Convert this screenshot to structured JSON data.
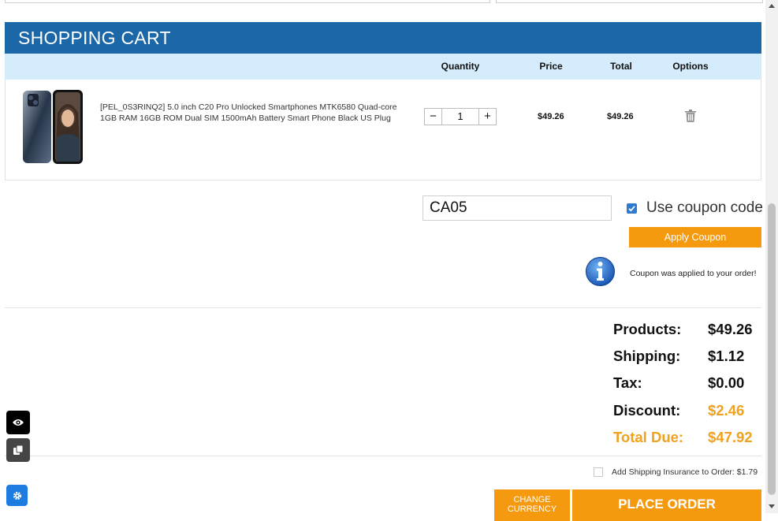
{
  "cart": {
    "title": "SHOPPING CART",
    "columns": {
      "quantity": "Quantity",
      "price": "Price",
      "total": "Total",
      "options": "Options"
    },
    "item": {
      "description": "[PEL_0S3RINQ2] 5.0 inch C20 Pro Unlocked Smartphones MTK6580 Quad-core 1GB RAM 16GB ROM Dual SIM 1500mAh Battery Smart Phone Black US Plug",
      "quantity": "1",
      "minus": "−",
      "plus": "+",
      "price": "$49.26",
      "total": "$49.26"
    }
  },
  "coupon": {
    "code": "CA05",
    "checked": true,
    "label": "Use coupon code",
    "apply_label": "Apply Coupon",
    "message": "Coupon was applied to your order!"
  },
  "summary": {
    "products_label": "Products:",
    "products_value": "$49.26",
    "shipping_label": "Shipping:",
    "shipping_value": "$1.12",
    "tax_label": "Tax:",
    "tax_value": "$0.00",
    "discount_label": "Discount:",
    "discount_value": "$2.46",
    "total_label": "Total Due:",
    "total_value": "$47.92"
  },
  "insurance": {
    "label": "Add Shipping Insurance to Order: $1.79",
    "checked": false
  },
  "actions": {
    "change_currency": "CHANGE CURRENCY",
    "place_order": "PLACE ORDER"
  },
  "colors": {
    "header": "#1b67a8",
    "column_bar": "#d4ecfb",
    "accent_orange": "#f59a0f",
    "discount_orange": "#f0a21c"
  },
  "icons": {
    "delete": "trash-icon",
    "info": "info-icon",
    "eye": "eye-icon",
    "copy": "copy-icon",
    "settings": "gear-icon"
  }
}
